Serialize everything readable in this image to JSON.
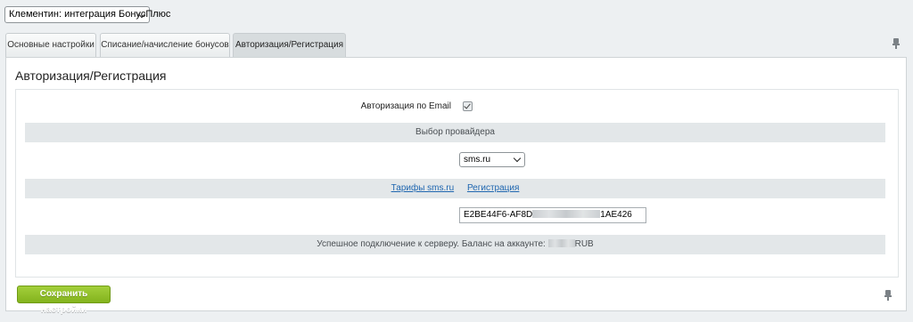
{
  "site_select": {
    "value": "Клементин: интеграция БонусПлюс"
  },
  "tabs": [
    {
      "label": "Основные настройки",
      "active": false
    },
    {
      "label": "Списание/начисление бонусов",
      "active": false
    },
    {
      "label": "Авторизация/Регистрация",
      "active": true
    }
  ],
  "panel": {
    "title": "Авторизация/Регистрация",
    "email_auth": {
      "label": "Авторизация по Email",
      "checked": true
    },
    "provider_section": "Выбор провайдера",
    "provider_select": {
      "value": "sms.ru"
    },
    "links": {
      "tariffs": "Тарифы sms.ru",
      "registration": "Регистрация"
    },
    "api_key": {
      "prefix": "E2BE44F6-AF8D",
      "suffix": "1AE426"
    },
    "status": {
      "prefix": "Успешное подключение к серверу. Баланс на аккаунте:",
      "currency": "RUB"
    }
  },
  "footer": {
    "save_label": "Сохранить настройки"
  },
  "icons": {
    "pin": "pin-icon",
    "check": "check-icon",
    "chevron": "chevron-down-icon"
  },
  "colors": {
    "save_button": "#8dbd26",
    "link": "#2067b0",
    "section_bg": "#e3e7e9"
  }
}
